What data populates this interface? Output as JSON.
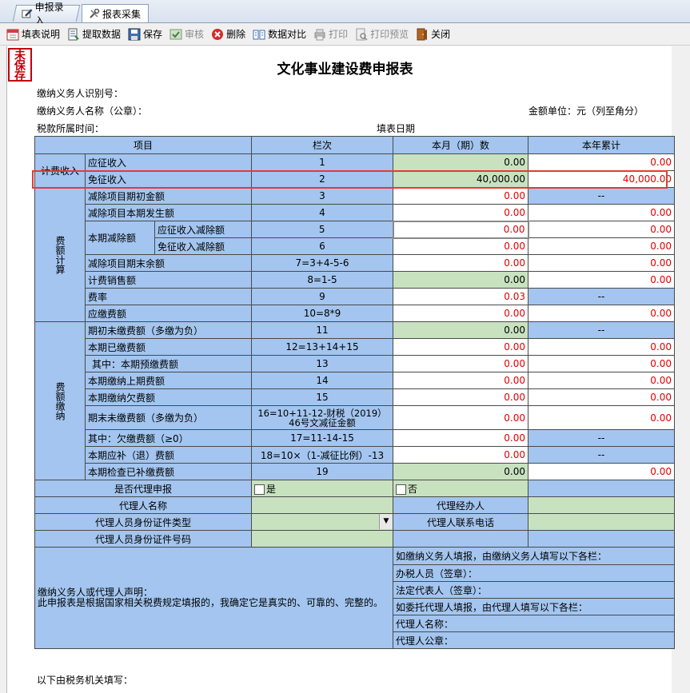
{
  "tabs": [
    {
      "label": "申报录入",
      "icon": "edit-icon"
    },
    {
      "label": "报表采集",
      "icon": "tools-icon"
    }
  ],
  "toolbar": {
    "fill_help": "填表说明",
    "extract": "提取数据",
    "save": "保存",
    "review": "审核",
    "delete": "删除",
    "compare": "数据对比",
    "print": "打印",
    "print_preview": "打印预览",
    "close": "关闭"
  },
  "stamp": "未保存",
  "title": "文化事业建设费申报表",
  "header": {
    "taxpayer_id": "缴纳义务人识别号：",
    "taxpayer_name": "缴纳义务人名称（公章）：",
    "amount_unit": "金额单位：元（列至角分）",
    "period": "税款所属时间：",
    "fill_date": "填表日期"
  },
  "columns": {
    "item": "项目",
    "col": "栏次",
    "month": "本月（期）数",
    "year": "本年累计"
  },
  "groups": {
    "revenue": "计费收入",
    "calc": "费额计算",
    "payment": "费额缴纳"
  },
  "rows": [
    {
      "label": "应征收入",
      "col": "1",
      "month": "0.00",
      "year": "0.00"
    },
    {
      "label": "免征收入",
      "col": "2",
      "month": "40,000.00",
      "year": "40,000.00"
    },
    {
      "label": "减除项目期初金额",
      "col": "3",
      "month": "0.00",
      "year": "--"
    },
    {
      "label": "减除项目本期发生额",
      "col": "4",
      "month": "0.00",
      "year": "0.00"
    },
    {
      "label": "应征收入减除额",
      "col": "5",
      "month": "0.00",
      "year": "0.00"
    },
    {
      "label": "免征收入减除额",
      "col": "6",
      "month": "0.00",
      "year": "0.00"
    },
    {
      "label": "减除项目期末余额",
      "col": "7=3+4-5-6",
      "month": "0.00",
      "year": "0.00"
    },
    {
      "label": "计费销售额",
      "col": "8=1-5",
      "month": "0.00",
      "year": "0.00"
    },
    {
      "label": "费率",
      "col": "9",
      "month": "0.03",
      "year": "--"
    },
    {
      "label": "应缴费额",
      "col": "10=8*9",
      "month": "0.00",
      "year": "0.00"
    },
    {
      "label": "期初未缴费额（多缴为负）",
      "col": "11",
      "month": "0.00",
      "year": "--"
    },
    {
      "label": "本期已缴费额",
      "col": "12=13+14+15",
      "month": "0.00",
      "year": "0.00"
    },
    {
      "label": "其中：本期预缴费额",
      "col": "13",
      "month": "0.00",
      "year": "0.00"
    },
    {
      "label": "本期缴纳上期费额",
      "col": "14",
      "month": "0.00",
      "year": "0.00"
    },
    {
      "label": "本期缴纳欠费额",
      "col": "15",
      "month": "0.00",
      "year": "0.00"
    },
    {
      "label": "期末未缴费额（多缴为负）",
      "col": "16=10+11-12-财税（2019）46号文减征金额",
      "month": "0.00",
      "year": "0.00"
    },
    {
      "label": "其中：欠缴费额（≥0）",
      "col": "17=11-14-15",
      "month": "0.00",
      "year": "--"
    },
    {
      "label": "本期应补（退）费额",
      "col": "18=10×（1-减征比例）-13",
      "month": "0.00",
      "year": "--"
    },
    {
      "label": "本期检查已补缴费额",
      "col": "19",
      "month": "0.00",
      "year": "0.00"
    }
  ],
  "deduction_group": "本期减除额",
  "agent": {
    "is_agent": "是否代理申报",
    "yes": "是",
    "no": "否",
    "agent_name": "代理人名称",
    "agent_handler": "代理经办人",
    "id_type": "代理人员身份证件类型",
    "agent_phone": "代理人联系电话",
    "id_number": "代理人员身份证件号码"
  },
  "declaration": {
    "left_line1": "缴纳义务人或代理人声明：",
    "left_line2": "此申报表是根据国家相关税费规定填报的，我确定它是真实的、可靠的、完整的。",
    "r1": "如缴纳义务人填报，由缴纳义务人填写以下各栏：",
    "r2": "办税人员（签章）：",
    "r3": "法定代表人（签章）：",
    "r4": "如委托代理人填报，由代理人填写以下各栏：",
    "r5": "代理人名称：",
    "r6": "代理人公章："
  },
  "footer": "以下由税务机关填写："
}
